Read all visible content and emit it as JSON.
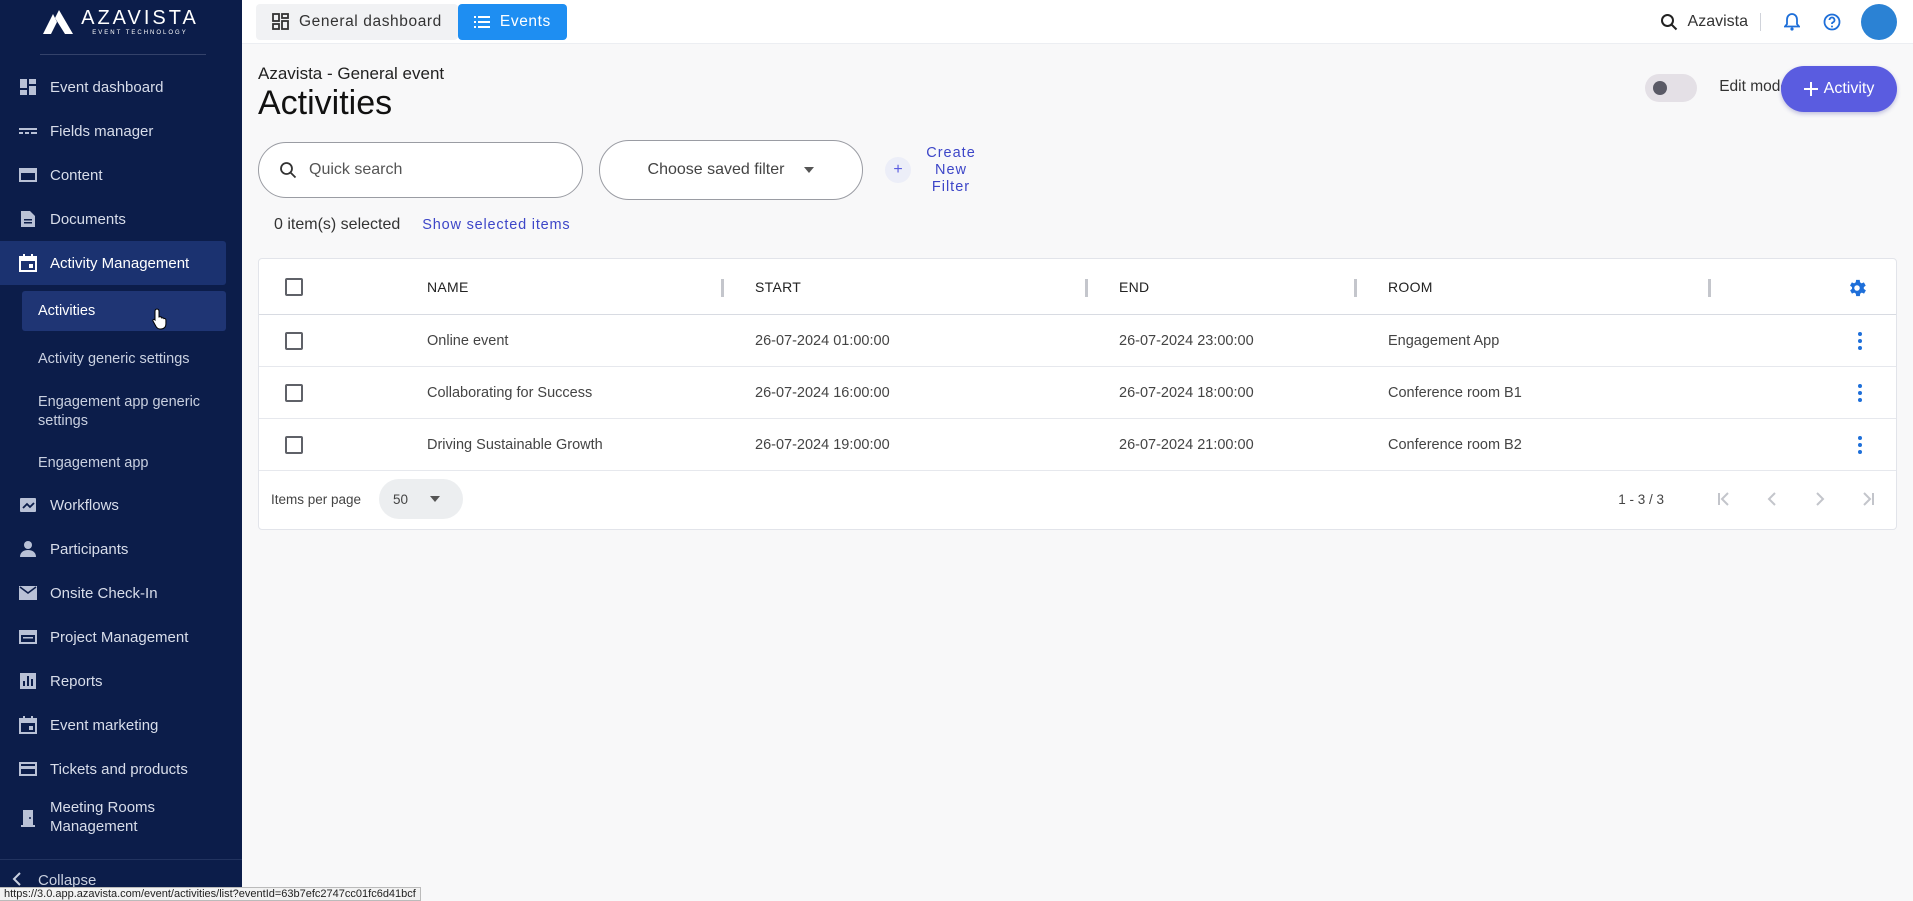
{
  "brand": {
    "name": "AZAVISTA",
    "tagline": "EVENT TECHNOLOGY"
  },
  "sidebar": {
    "items": [
      {
        "label": "Event dashboard",
        "icon": "dashboard-icon"
      },
      {
        "label": "Fields manager",
        "icon": "fields-icon"
      },
      {
        "label": "Content",
        "icon": "content-icon"
      },
      {
        "label": "Documents",
        "icon": "document-icon"
      },
      {
        "label": "Activity Management",
        "icon": "calendar-icon",
        "active": true
      },
      {
        "label": "Workflows",
        "icon": "workflow-icon"
      },
      {
        "label": "Participants",
        "icon": "person-icon"
      },
      {
        "label": "Onsite Check-In",
        "icon": "mail-icon"
      },
      {
        "label": "Project Management",
        "icon": "project-icon"
      },
      {
        "label": "Reports",
        "icon": "chart-icon"
      },
      {
        "label": "Event marketing",
        "icon": "calendar-icon"
      },
      {
        "label": "Tickets and products",
        "icon": "card-icon"
      },
      {
        "label": "Meeting Rooms Management",
        "icon": "door-icon"
      }
    ],
    "sub_items": [
      {
        "label": "Activities",
        "active": true
      },
      {
        "label": "Activity generic settings"
      },
      {
        "label": "Engagement app generic settings"
      },
      {
        "label": "Engagement app"
      }
    ],
    "collapse_label": "Collapse"
  },
  "topbar": {
    "tabs": [
      {
        "label": "General dashboard",
        "icon": "grid-icon"
      },
      {
        "label": "Events",
        "icon": "list-icon",
        "active": true
      }
    ],
    "org_label": "Azavista"
  },
  "main": {
    "breadcrumb": "Azavista - General event",
    "title": "Activities",
    "edit_mode_label": "Edit mode",
    "add_button_label": "Activity",
    "search_placeholder": "Quick search",
    "saved_filter_label": "Choose saved filter",
    "create_filter_label": "Create New Filter",
    "selected_count": "0 item(s) selected",
    "show_selected_label": "Show selected items"
  },
  "table": {
    "columns": [
      "NAME",
      "START",
      "END",
      "ROOM"
    ],
    "rows": [
      {
        "name": "Online event",
        "start": "26-07-2024 01:00:00",
        "end": "26-07-2024 23:00:00",
        "room": "Engagement App"
      },
      {
        "name": "Collaborating for Success",
        "start": "26-07-2024 16:00:00",
        "end": "26-07-2024 18:00:00",
        "room": "Conference room B1"
      },
      {
        "name": "Driving Sustainable Growth",
        "start": "26-07-2024 19:00:00",
        "end": "26-07-2024 21:00:00",
        "room": "Conference room B2"
      }
    ],
    "items_per_page_label": "Items per page",
    "items_per_page_value": "50",
    "range_label": "1 - 3 / 3"
  },
  "status_url": "https://3.0.app.azavista.com/event/activities/list?eventId=63b7efc2747cc01fc6d41bcf",
  "colors": {
    "sidebar_bg": "#0c1d4a",
    "accent": "#1e8ef2",
    "primary_button": "#5a5ce0",
    "link": "#3d46c8"
  }
}
